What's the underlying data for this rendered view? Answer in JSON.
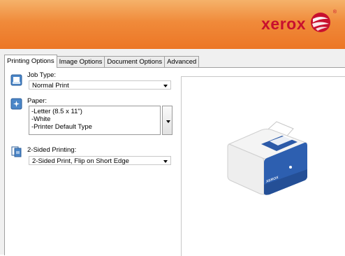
{
  "brand": {
    "name": "xerox",
    "reg": "®",
    "color": "#c8102e"
  },
  "tabs": [
    {
      "label": "Printing Options",
      "active": true
    },
    {
      "label": "Image Options",
      "active": false
    },
    {
      "label": "Document Options",
      "active": false
    },
    {
      "label": "Advanced",
      "active": false
    }
  ],
  "job_type": {
    "label": "Job Type:",
    "value": "Normal Print"
  },
  "paper": {
    "label": "Paper:",
    "lines": [
      "-Letter (8.5 x 11\")",
      "-White",
      "-Printer Default Type"
    ]
  },
  "two_sided": {
    "label": "2-Sided Printing:",
    "value": "2-Sided Print, Flip on Short Edge"
  },
  "printer_badge": "XEROX"
}
